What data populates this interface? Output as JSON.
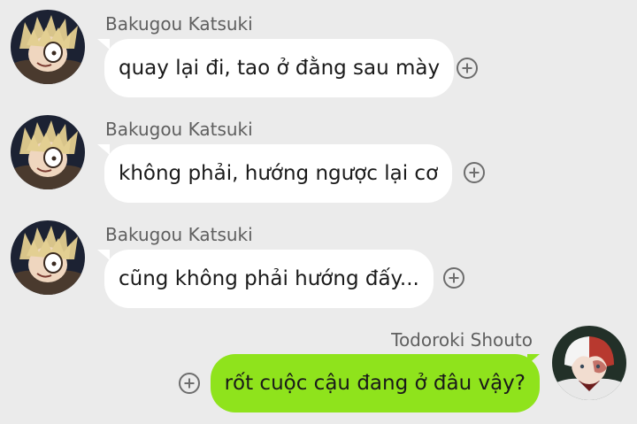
{
  "colors": {
    "background": "#ebebeb",
    "incoming_bubble": "#ffffff",
    "outgoing_bubble": "#8fe31c",
    "sender_name": "#5f5f5f"
  },
  "messages": [
    {
      "sender": "Bakugou Katsuki",
      "text": "quay lại đi, tao ở đằng sau mày",
      "direction": "incoming",
      "avatar_icon": "bakugou-avatar-icon",
      "react_icon": "add-reaction-icon"
    },
    {
      "sender": "Bakugou Katsuki",
      "text": "không phải, hướng ngược lại cơ",
      "direction": "incoming",
      "avatar_icon": "bakugou-avatar-icon",
      "react_icon": "add-reaction-icon"
    },
    {
      "sender": "Bakugou Katsuki",
      "text": "cũng không phải hướng đấy...",
      "direction": "incoming",
      "avatar_icon": "bakugou-avatar-icon",
      "react_icon": "add-reaction-icon"
    },
    {
      "sender": "Todoroki Shouto",
      "text": "rốt cuộc cậu đang ở đâu vậy?",
      "direction": "outgoing",
      "avatar_icon": "todoroki-avatar-icon",
      "react_icon": "add-reaction-icon"
    }
  ]
}
